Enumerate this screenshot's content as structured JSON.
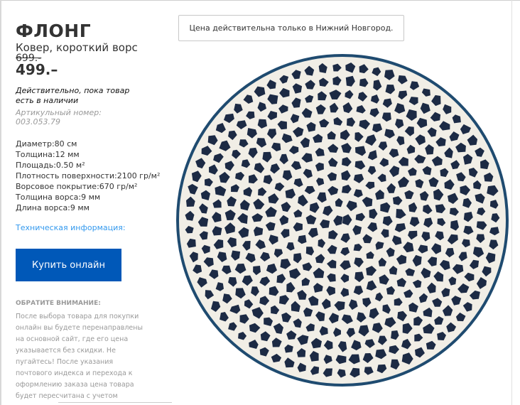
{
  "product": {
    "name": "ФЛОНГ",
    "description": "Ковер, короткий ворс",
    "old_price": "699.-",
    "price": "499.–",
    "validity": "Действительно, пока товар есть в наличии",
    "article": "Артикульный номер: 003.053.79"
  },
  "specs": [
    "Диаметр:80 см",
    "Толщина:12 мм",
    "Площадь:0.50 м²",
    "Плотность поверхности:2100 гр/м²",
    "Ворсовое покрытие:670 гр/м²",
    "Толщина ворса:9 мм",
    "Длина ворса:9 мм"
  ],
  "tech_link": "Техническая информация:",
  "buy_button": "Купить онлайн",
  "notice": {
    "heading": "ОБРАТИТЕ ВНИМАНИЕ:",
    "text": "После выбора товара для покупки онлайн вы будете перенаправлены на основной сайт, где его цена указывается без скидки. Не пугайтесь! После указания почтового индекса и перехода к оформлению заказа цена товара будет пересчитана с учетом"
  },
  "city_notice": "Цена действительна только в Нижний Новгород.",
  "colors": {
    "accent": "#0058b8",
    "link": "#3399ee",
    "rug_dots": "#1c2a44",
    "rug_base": "#f1eee6",
    "rug_border": "#1f4b70"
  }
}
